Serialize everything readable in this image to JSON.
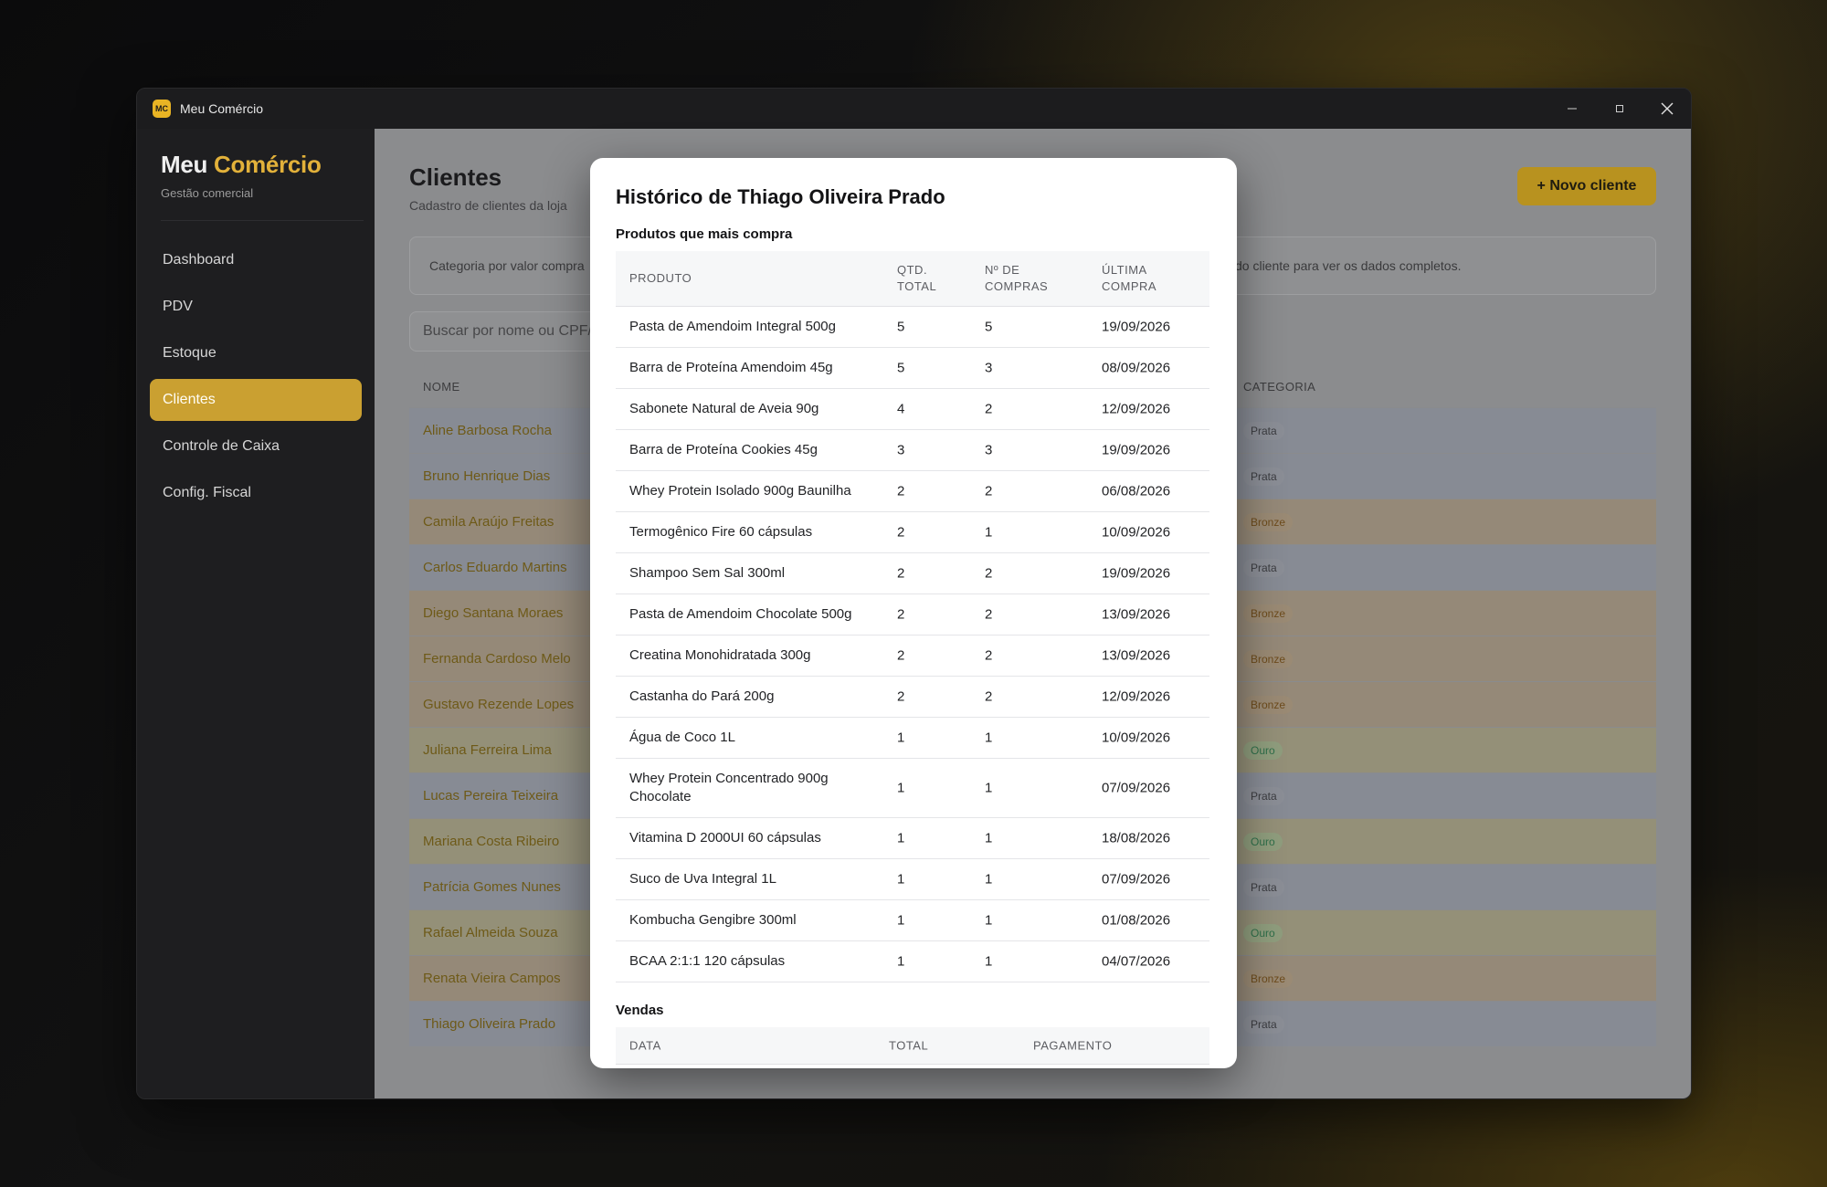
{
  "window": {
    "title": "Meu Comércio",
    "icon_text": "MC"
  },
  "sidebar": {
    "brand_first": "Meu",
    "brand_accent": "Comércio",
    "subtitle": "Gestão comercial",
    "items": [
      {
        "label": "Dashboard"
      },
      {
        "label": "PDV"
      },
      {
        "label": "Estoque"
      },
      {
        "label": "Clientes",
        "active": true
      },
      {
        "label": "Controle de Caixa"
      },
      {
        "label": "Config. Fiscal"
      }
    ]
  },
  "page": {
    "title": "Clientes",
    "subtitle": "Cadastro de clientes da loja",
    "new_button": "+ Novo cliente",
    "info_left": "Categoria por valor compra",
    "info_right": "do cliente para ver os dados completos.",
    "search_placeholder": "Buscar por nome ou CPF/"
  },
  "clients_table": {
    "headers": {
      "name": "NOME",
      "category": "CATEGORIA"
    },
    "rows": [
      {
        "name": "Aline Barbosa Rocha",
        "category": "Prata"
      },
      {
        "name": "Bruno Henrique Dias",
        "category": "Prata"
      },
      {
        "name": "Camila Araújo Freitas",
        "category": "Bronze"
      },
      {
        "name": "Carlos Eduardo Martins",
        "category": "Prata"
      },
      {
        "name": "Diego Santana Moraes",
        "category": "Bronze"
      },
      {
        "name": "Fernanda Cardoso Melo",
        "category": "Bronze"
      },
      {
        "name": "Gustavo Rezende Lopes",
        "category": "Bronze"
      },
      {
        "name": "Juliana Ferreira Lima",
        "category": "Ouro"
      },
      {
        "name": "Lucas Pereira Teixeira",
        "category": "Prata"
      },
      {
        "name": "Mariana Costa Ribeiro",
        "category": "Ouro"
      },
      {
        "name": "Patrícia Gomes Nunes",
        "category": "Prata"
      },
      {
        "name": "Rafael Almeida Souza",
        "category": "Ouro"
      },
      {
        "name": "Renata Vieira Campos",
        "category": "Bronze"
      },
      {
        "name": "Thiago Oliveira Prado",
        "category": "Prata"
      }
    ]
  },
  "modal": {
    "title": "Histórico de Thiago Oliveira Prado",
    "products_section": "Produtos que mais compra",
    "products_headers": {
      "product": "PRODUTO",
      "qty_1": "QTD.",
      "qty_2": "TOTAL",
      "purchases_1": "Nº DE",
      "purchases_2": "COMPRAS",
      "last_1": "ÚLTIMA",
      "last_2": "COMPRA"
    },
    "products": [
      {
        "product": "Pasta de Amendoim Integral 500g",
        "qty": "5",
        "purchases": "5",
        "last": "19/09/2026"
      },
      {
        "product": "Barra de Proteína Amendoim 45g",
        "qty": "5",
        "purchases": "3",
        "last": "08/09/2026"
      },
      {
        "product": "Sabonete Natural de Aveia 90g",
        "qty": "4",
        "purchases": "2",
        "last": "12/09/2026"
      },
      {
        "product": "Barra de Proteína Cookies 45g",
        "qty": "3",
        "purchases": "3",
        "last": "19/09/2026"
      },
      {
        "product": "Whey Protein Isolado 900g Baunilha",
        "qty": "2",
        "purchases": "2",
        "last": "06/08/2026"
      },
      {
        "product": "Termogênico Fire 60 cápsulas",
        "qty": "2",
        "purchases": "1",
        "last": "10/09/2026"
      },
      {
        "product": "Shampoo Sem Sal 300ml",
        "qty": "2",
        "purchases": "2",
        "last": "19/09/2026"
      },
      {
        "product": "Pasta de Amendoim Chocolate 500g",
        "qty": "2",
        "purchases": "2",
        "last": "13/09/2026"
      },
      {
        "product": "Creatina Monohidratada 300g",
        "qty": "2",
        "purchases": "2",
        "last": "13/09/2026"
      },
      {
        "product": "Castanha do Pará 200g",
        "qty": "2",
        "purchases": "2",
        "last": "12/09/2026"
      },
      {
        "product": "Água de Coco 1L",
        "qty": "1",
        "purchases": "1",
        "last": "10/09/2026"
      },
      {
        "product": "Whey Protein Concentrado 900g Chocolate",
        "qty": "1",
        "purchases": "1",
        "last": "07/09/2026"
      },
      {
        "product": "Vitamina D 2000UI 60 cápsulas",
        "qty": "1",
        "purchases": "1",
        "last": "18/08/2026"
      },
      {
        "product": "Suco de Uva Integral 1L",
        "qty": "1",
        "purchases": "1",
        "last": "07/09/2026"
      },
      {
        "product": "Kombucha Gengibre 300ml",
        "qty": "1",
        "purchases": "1",
        "last": "01/08/2026"
      },
      {
        "product": "BCAA 2:1:1 120 cápsulas",
        "qty": "1",
        "purchases": "1",
        "last": "04/07/2026"
      }
    ],
    "sales_section": "Vendas",
    "sales_headers": {
      "date": "DATA",
      "total": "TOTAL",
      "payment": "PAGAMENTO"
    }
  }
}
